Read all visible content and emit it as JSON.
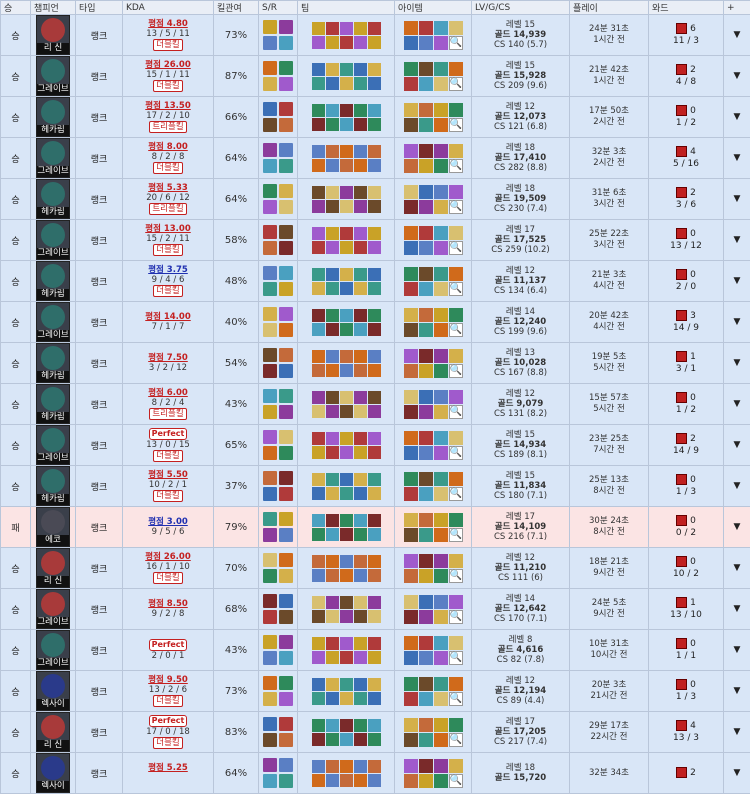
{
  "headers": {
    "result": "승",
    "champion": "챔피언",
    "type": "타입",
    "kda": "KDA",
    "kp": "킬관여",
    "sr": "S/R",
    "team": "팀",
    "items": "아이템",
    "lvgcs": "LV/G/CS",
    "play": "플레이",
    "ward": "와드",
    "more": "+"
  },
  "colors": {
    "win_row": "#d9e6f7",
    "loss_row": "#fbe4e4",
    "avg_red": "#c42020",
    "avg_blue": "#2030b0"
  },
  "icons": {
    "search": "🔍",
    "dropdown": "▼"
  },
  "rows": [
    {
      "result": "승",
      "win": true,
      "champ": "리 신",
      "champ_color": "#a83a3a",
      "type": "랭크",
      "avg": "평점 4.80",
      "avg_blue": false,
      "kda": "13 / 5 / 11",
      "badge": "더블킬",
      "kp": "73%",
      "lv": "레벨 15",
      "gold": "골드 14,939",
      "cs": "CS 140 (5.7)",
      "dur": "24분 31초",
      "ago": "1시간 전",
      "ward_pink": "6",
      "ward_counts": "11 / 3"
    },
    {
      "result": "승",
      "win": true,
      "champ": "그레이브",
      "champ_color": "#2f6e6a",
      "type": "랭크",
      "avg": "평점 26.00",
      "avg_blue": false,
      "kda": "15 / 1 / 11",
      "badge": "더블킬",
      "kp": "87%",
      "lv": "레벨 15",
      "gold": "골드 15,928",
      "cs": "CS 209 (9.6)",
      "dur": "21분 42초",
      "ago": "1시간 전",
      "ward_pink": "2",
      "ward_counts": "4 / 8"
    },
    {
      "result": "승",
      "win": true,
      "champ": "헤카림",
      "champ_color": "#2f6e6a",
      "type": "랭크",
      "avg": "평점 13.50",
      "avg_blue": false,
      "kda": "17 / 2 / 10",
      "badge": "트리플킬",
      "kp": "66%",
      "lv": "레벨 12",
      "gold": "골드 12,073",
      "cs": "CS 121 (6.8)",
      "dur": "17분 50초",
      "ago": "2시간 전",
      "ward_pink": "0",
      "ward_counts": "1 / 2"
    },
    {
      "result": "승",
      "win": true,
      "champ": "그레이브",
      "champ_color": "#2f6e6a",
      "type": "랭크",
      "avg": "평점 8.00",
      "avg_blue": false,
      "kda": "8 / 2 / 8",
      "badge": "더블킬",
      "kp": "64%",
      "lv": "레벨 18",
      "gold": "골드 17,410",
      "cs": "CS 282 (8.8)",
      "dur": "32분 3초",
      "ago": "2시간 전",
      "ward_pink": "4",
      "ward_counts": "5 / 16"
    },
    {
      "result": "승",
      "win": true,
      "champ": "헤카림",
      "champ_color": "#2f6e6a",
      "type": "랭크",
      "avg": "평점 5.33",
      "avg_blue": false,
      "kda": "20 / 6 / 12",
      "badge": "트리플킬",
      "kp": "64%",
      "lv": "레벨 18",
      "gold": "골드 19,509",
      "cs": "CS 230 (7.4)",
      "dur": "31분 6초",
      "ago": "3시간 전",
      "ward_pink": "2",
      "ward_counts": "3 / 6"
    },
    {
      "result": "승",
      "win": true,
      "champ": "그레이브",
      "champ_color": "#2f6e6a",
      "type": "랭크",
      "avg": "평점 13.00",
      "avg_blue": false,
      "kda": "15 / 2 / 11",
      "badge": "더블킬",
      "kp": "58%",
      "lv": "레벨 17",
      "gold": "골드 17,525",
      "cs": "CS 259 (10.2)",
      "dur": "25분 22초",
      "ago": "3시간 전",
      "ward_pink": "0",
      "ward_counts": "13 / 12"
    },
    {
      "result": "승",
      "win": true,
      "champ": "헤카림",
      "champ_color": "#2f6e6a",
      "type": "랭크",
      "avg": "평점 3.75",
      "avg_blue": true,
      "kda": "9 / 4 / 6",
      "badge": "더블킬",
      "kp": "48%",
      "lv": "레벨 12",
      "gold": "골드 11,137",
      "cs": "CS 134 (6.4)",
      "dur": "21분 3초",
      "ago": "4시간 전",
      "ward_pink": "0",
      "ward_counts": "2 / 0"
    },
    {
      "result": "승",
      "win": true,
      "champ": "그레이브",
      "champ_color": "#2f6e6a",
      "type": "랭크",
      "avg": "평점 14.00",
      "avg_blue": false,
      "kda": "7 / 1 / 7",
      "badge": "",
      "kp": "40%",
      "lv": "레벨 14",
      "gold": "골드 12,240",
      "cs": "CS 199 (9.6)",
      "dur": "20분 42초",
      "ago": "4시간 전",
      "ward_pink": "3",
      "ward_counts": "14 / 9"
    },
    {
      "result": "승",
      "win": true,
      "champ": "헤카림",
      "champ_color": "#2f6e6a",
      "type": "랭크",
      "avg": "평점 7.50",
      "avg_blue": false,
      "kda": "3 / 2 / 12",
      "badge": "",
      "kp": "54%",
      "lv": "레벨 13",
      "gold": "골드 10,028",
      "cs": "CS 167 (8.8)",
      "dur": "19분 5초",
      "ago": "5시간 전",
      "ward_pink": "1",
      "ward_counts": "3 / 1"
    },
    {
      "result": "승",
      "win": true,
      "champ": "헤카림",
      "champ_color": "#2f6e6a",
      "type": "랭크",
      "avg": "평점 6.00",
      "avg_blue": false,
      "kda": "8 / 2 / 4",
      "badge": "트리플킬",
      "kp": "43%",
      "lv": "레벨 12",
      "gold": "골드 9,079",
      "cs": "CS 131 (8.2)",
      "dur": "15분 57초",
      "ago": "5시간 전",
      "ward_pink": "0",
      "ward_counts": "1 / 2"
    },
    {
      "result": "승",
      "win": true,
      "champ": "그레이브",
      "champ_color": "#2f6e6a",
      "type": "랭크",
      "avg": "Perfect",
      "avg_blue": false,
      "kda": "13 / 0 / 15",
      "badge": "더블킬",
      "kp": "65%",
      "lv": "레벨 15",
      "gold": "골드 14,934",
      "cs": "CS 189 (8.1)",
      "dur": "23분 25초",
      "ago": "7시간 전",
      "ward_pink": "2",
      "ward_counts": "14 / 9"
    },
    {
      "result": "승",
      "win": true,
      "champ": "헤카림",
      "champ_color": "#2f6e6a",
      "type": "랭크",
      "avg": "평점 5.50",
      "avg_blue": false,
      "kda": "10 / 2 / 1",
      "badge": "더블킬",
      "kp": "37%",
      "lv": "레벨 15",
      "gold": "골드 11,834",
      "cs": "CS 180 (7.1)",
      "dur": "25분 13초",
      "ago": "8시간 전",
      "ward_pink": "0",
      "ward_counts": "1 / 3"
    },
    {
      "result": "패",
      "win": false,
      "champ": "에코",
      "champ_color": "#4a4a55",
      "type": "랭크",
      "avg": "평점 3.00",
      "avg_blue": true,
      "kda": "9 / 5 / 6",
      "badge": "",
      "kp": "79%",
      "lv": "레벨 17",
      "gold": "골드 14,109",
      "cs": "CS 216 (7.1)",
      "dur": "30분 24초",
      "ago": "8시간 전",
      "ward_pink": "0",
      "ward_counts": "0 / 2"
    },
    {
      "result": "승",
      "win": true,
      "champ": "리 신",
      "champ_color": "#a83a3a",
      "type": "랭크",
      "avg": "평점 26.00",
      "avg_blue": false,
      "kda": "16 / 1 / 10",
      "badge": "더블킬",
      "kp": "70%",
      "lv": "레벨 12",
      "gold": "골드 11,210",
      "cs": "CS 111 (6)",
      "dur": "18분 21초",
      "ago": "9시간 전",
      "ward_pink": "0",
      "ward_counts": "10 / 2"
    },
    {
      "result": "승",
      "win": true,
      "champ": "그레이브",
      "champ_color": "#a83a3a",
      "type": "랭크",
      "avg": "평점 8.50",
      "avg_blue": false,
      "kda": "9 / 2 / 8",
      "badge": "",
      "kp": "68%",
      "lv": "레벨 14",
      "gold": "골드 12,642",
      "cs": "CS 170 (7.1)",
      "dur": "24분 5초",
      "ago": "9시간 전",
      "ward_pink": "1",
      "ward_counts": "13 / 10"
    },
    {
      "result": "승",
      "win": true,
      "champ": "그레이브",
      "champ_color": "#2f6e6a",
      "type": "랭크",
      "avg": "Perfect",
      "avg_blue": false,
      "kda": "2 / 0 / 1",
      "badge": "",
      "kp": "43%",
      "lv": "레벨 8",
      "gold": "골드 4,616",
      "cs": "CS 82 (7.8)",
      "dur": "10분 31초",
      "ago": "10시간 전",
      "ward_pink": "0",
      "ward_counts": "1 / 1"
    },
    {
      "result": "승",
      "win": true,
      "champ": "렉사이",
      "champ_color": "#2a3a8a",
      "type": "랭크",
      "avg": "평점 9.50",
      "avg_blue": false,
      "kda": "13 / 2 / 6",
      "badge": "더블킬",
      "kp": "73%",
      "lv": "레벨 12",
      "gold": "골드 12,194",
      "cs": "CS 89 (4.4)",
      "dur": "20분 3초",
      "ago": "21시간 전",
      "ward_pink": "0",
      "ward_counts": "1 / 3"
    },
    {
      "result": "승",
      "win": true,
      "champ": "리 신",
      "champ_color": "#a83a3a",
      "type": "랭크",
      "avg": "Perfect",
      "avg_blue": false,
      "kda": "17 / 0 / 18",
      "badge": "더블킬",
      "kp": "83%",
      "lv": "레벨 17",
      "gold": "골드 17,205",
      "cs": "CS 217 (7.4)",
      "dur": "29분 17초",
      "ago": "22시간 전",
      "ward_pink": "4",
      "ward_counts": "13 / 3"
    },
    {
      "result": "승",
      "win": true,
      "champ": "렉사이",
      "champ_color": "#2a3a8a",
      "type": "랭크",
      "avg": "평점 5.25",
      "avg_blue": false,
      "kda": "",
      "badge": "",
      "kp": "64%",
      "lv": "레벨 18",
      "gold": "골드 15,720",
      "cs": "",
      "dur": "32분 34초",
      "ago": "",
      "ward_pink": "2",
      "ward_counts": ""
    }
  ]
}
